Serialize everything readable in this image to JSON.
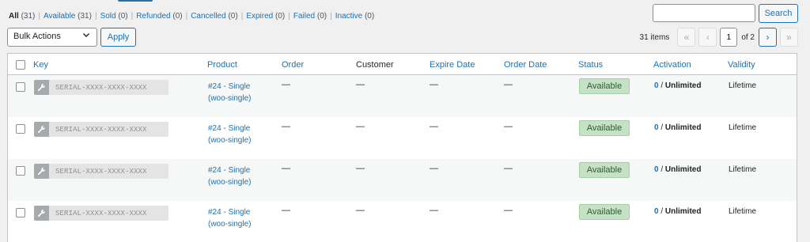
{
  "filters": [
    {
      "label": "All",
      "count": "(31)"
    },
    {
      "label": "Available",
      "count": "(31)"
    },
    {
      "label": "Sold",
      "count": "(0)"
    },
    {
      "label": "Refunded",
      "count": "(0)"
    },
    {
      "label": "Cancelled",
      "count": "(0)"
    },
    {
      "label": "Expired",
      "count": "(0)"
    },
    {
      "label": "Failed",
      "count": "(0)"
    },
    {
      "label": "Inactive",
      "count": "(0)"
    }
  ],
  "search": {
    "value": "",
    "button_label": "Search"
  },
  "bulk_actions": {
    "selected": "Bulk Actions",
    "apply_label": "Apply"
  },
  "pagination": {
    "items_text": "31 items",
    "first": "«",
    "prev": "‹",
    "current_page": "1",
    "of_text": "of 2",
    "next": "›",
    "last": "»"
  },
  "columns": {
    "key": "Key",
    "product": "Product",
    "order": "Order",
    "customer": "Customer",
    "expire_date": "Expire Date",
    "order_date": "Order Date",
    "status": "Status",
    "activation": "Activation",
    "validity": "Validity"
  },
  "rows": [
    {
      "key": "SERIAL-XXXX-XXXX-XXXX",
      "product_line1": "#24 - Single",
      "product_line2": "(woo-single)",
      "order": "—",
      "customer": "—",
      "expire_date": "—",
      "order_date": "—",
      "status": "Available",
      "activation_count": "0",
      "activation_sep": " / ",
      "activation_limit": "Unlimited",
      "validity": "Lifetime"
    },
    {
      "key": "SERIAL-XXXX-XXXX-XXXX",
      "product_line1": "#24 - Single",
      "product_line2": "(woo-single)",
      "order": "—",
      "customer": "—",
      "expire_date": "—",
      "order_date": "—",
      "status": "Available",
      "activation_count": "0",
      "activation_sep": " / ",
      "activation_limit": "Unlimited",
      "validity": "Lifetime"
    },
    {
      "key": "SERIAL-XXXX-XXXX-XXXX",
      "product_line1": "#24 - Single",
      "product_line2": "(woo-single)",
      "order": "—",
      "customer": "—",
      "expire_date": "—",
      "order_date": "—",
      "status": "Available",
      "activation_count": "0",
      "activation_sep": " / ",
      "activation_limit": "Unlimited",
      "validity": "Lifetime"
    },
    {
      "key": "SERIAL-XXXX-XXXX-XXXX",
      "product_line1": "#24 - Single",
      "product_line2": "(woo-single)",
      "order": "—",
      "customer": "—",
      "expire_date": "—",
      "order_date": "—",
      "status": "Available",
      "activation_count": "0",
      "activation_sep": " / ",
      "activation_limit": "Unlimited",
      "validity": "Lifetime"
    }
  ],
  "colors": {
    "link": "#2271b1",
    "status_bg": "#c6e1c6",
    "status_text": "#2c5e2e",
    "alt_row": "#f6f7f7"
  },
  "icons": {
    "key_icon": "wrench-icon",
    "select_chevron": "chevron-down-icon"
  }
}
